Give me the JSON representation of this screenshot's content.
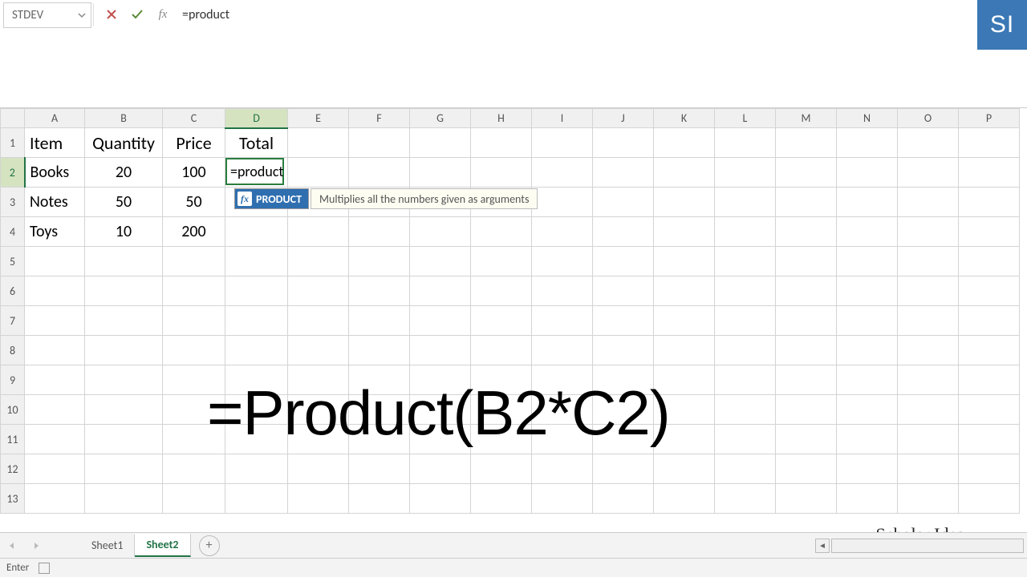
{
  "namebox": {
    "value": "STDEV"
  },
  "formula_bar": {
    "input": "=product"
  },
  "badge": "SI",
  "columns": [
    "A",
    "B",
    "C",
    "D",
    "E",
    "F",
    "G",
    "H",
    "I",
    "J",
    "K",
    "L",
    "M",
    "N",
    "O",
    "P"
  ],
  "active_col": "D",
  "rows": [
    "1",
    "2",
    "3",
    "4",
    "5",
    "6",
    "7",
    "8",
    "9",
    "10",
    "11",
    "12",
    "13"
  ],
  "active_row": "2",
  "headers": {
    "A": "Item",
    "B": "Quantity",
    "C": "Price",
    "D": "Total"
  },
  "data_rows": [
    {
      "A": "Books",
      "B": "20",
      "C": "100"
    },
    {
      "A": "Notes",
      "B": "50",
      "C": "50"
    },
    {
      "A": "Toys",
      "B": "10",
      "C": "200"
    }
  ],
  "editing": {
    "text": "=product"
  },
  "autocomplete": {
    "name": "PRODUCT",
    "desc": "Multiplies all the numbers given as arguments"
  },
  "overlay_formula": "=Product(B2*C2)",
  "tabs": {
    "sheet1": "Sheet1",
    "sheet2": "Sheet2"
  },
  "status": {
    "mode": "Enter"
  },
  "watermark": "Scholar Idea",
  "chart_data": {
    "type": "table",
    "columns": [
      "Item",
      "Quantity",
      "Price",
      "Total"
    ],
    "rows": [
      [
        "Books",
        20,
        100,
        null
      ],
      [
        "Notes",
        50,
        50,
        null
      ],
      [
        "Toys",
        10,
        200,
        null
      ]
    ],
    "formula_overlay": "=Product(B2*C2)"
  }
}
